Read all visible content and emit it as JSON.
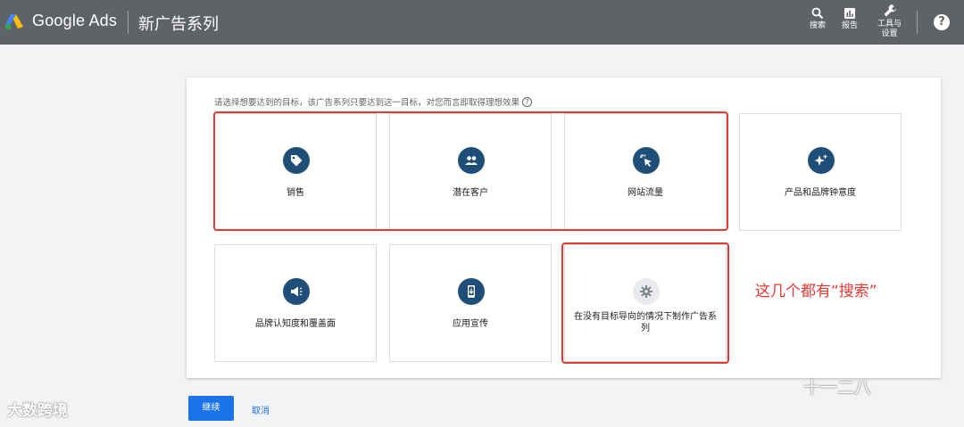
{
  "header": {
    "brand": "Google Ads",
    "page_title": "新广告系列",
    "search_label": "搜索",
    "reports_label": "报告",
    "tools_label_line1": "工具与",
    "tools_label_line2": "设置",
    "help_label": "?"
  },
  "goal_panel": {
    "instruction": "请选择想要达到的目标，该广告系列只要达到这一目标，对您而言即取得理想效果",
    "help_icon": "?",
    "cards": [
      {
        "label": "销售",
        "icon": "tag-icon"
      },
      {
        "label": "潜在客户",
        "icon": "people-icon"
      },
      {
        "label": "网站流量",
        "icon": "cursor-click-icon"
      },
      {
        "label": "产品和品牌钟意度",
        "icon": "sparkle-icon"
      },
      {
        "label": "品牌认知度和覆盖面",
        "icon": "megaphone-icon"
      },
      {
        "label": "应用宣传",
        "icon": "phone-download-icon"
      },
      {
        "label": "在没有目标导向的情况下制作广告系列",
        "icon": "gear-icon"
      }
    ]
  },
  "annotation": "这几个都有“搜索”",
  "actions": {
    "continue_label": "继续",
    "cancel_label": "取消"
  },
  "watermarks": {
    "left": "大数跨境",
    "right": "十一二八"
  },
  "colors": {
    "header_bg": "#5f6368",
    "icon_circle": "#1f4e79",
    "primary_button": "#1a73e8",
    "highlight_red": "#e53935"
  }
}
